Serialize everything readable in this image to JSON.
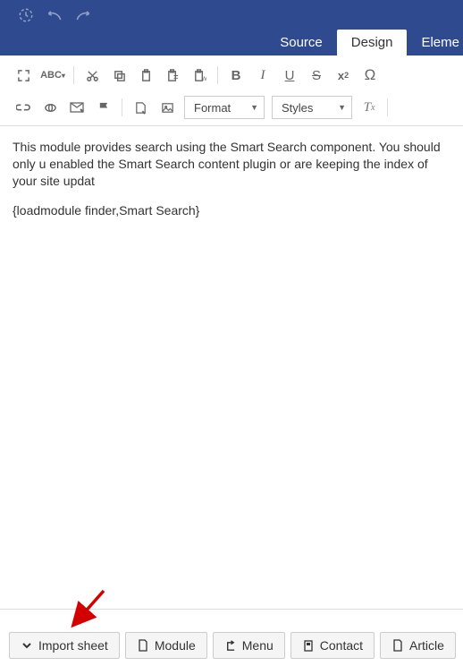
{
  "header": {
    "tabs": {
      "source": "Source",
      "design": "Design",
      "element": "Eleme"
    }
  },
  "dropdowns": {
    "format": "Format",
    "styles": "Styles"
  },
  "content": {
    "para1": "This module provides search using the Smart Search component. You should only u enabled the Smart Search content plugin or are keeping the index of your site updat",
    "para2": "{loadmodule finder,Smart Search}"
  },
  "bottom": {
    "import_sheet": "Import sheet",
    "module": "Module",
    "menu": "Menu",
    "contact": "Contact",
    "article": "Article"
  }
}
